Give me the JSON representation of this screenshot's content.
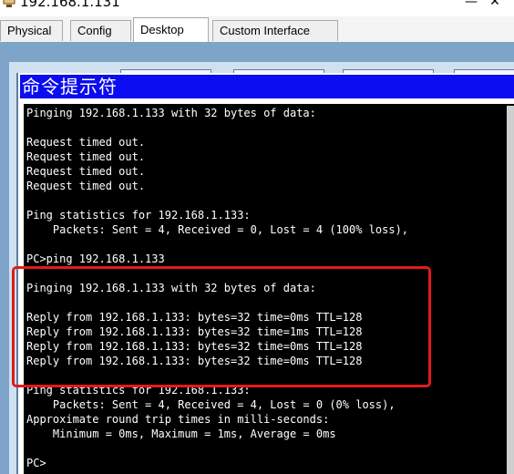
{
  "window": {
    "title": "192.168.1.131",
    "icon": "packet-tracer-pc-icon",
    "minimize_glyph": "—",
    "close_glyph": "✕"
  },
  "tabs": [
    {
      "label": "Physical",
      "active": false
    },
    {
      "label": "Config",
      "active": false
    },
    {
      "label": "Desktop",
      "active": true
    },
    {
      "label": "Custom Interface",
      "active": false
    }
  ],
  "cmd": {
    "title": "命令提示符",
    "lines": [
      "Pinging 192.168.1.133 with 32 bytes of data:",
      "",
      "Request timed out.",
      "Request timed out.",
      "Request timed out.",
      "Request timed out.",
      "",
      "Ping statistics for 192.168.1.133:",
      "    Packets: Sent = 4, Received = 0, Lost = 4 (100% loss),",
      "",
      "PC>ping 192.168.1.133",
      "",
      "Pinging 192.168.1.133 with 32 bytes of data:",
      "",
      "Reply from 192.168.1.133: bytes=32 time=0ms TTL=128",
      "Reply from 192.168.1.133: bytes=32 time=1ms TTL=128",
      "Reply from 192.168.1.133: bytes=32 time=0ms TTL=128",
      "Reply from 192.168.1.133: bytes=32 time=0ms TTL=128",
      "",
      "Ping statistics for 192.168.1.133:",
      "    Packets: Sent = 4, Received = 4, Lost = 0 (0% loss),",
      "Approximate round trip times in milli-seconds:",
      "    Minimum = 0ms, Maximum = 1ms, Average = 0ms",
      "",
      "PC>"
    ]
  },
  "colors": {
    "cmd_title_bg": "#0c0cf0",
    "console_bg": "#000000",
    "console_text": "#ffffff",
    "highlight_border": "#e21a1a",
    "desktop_bg": "#7fa4c9"
  }
}
